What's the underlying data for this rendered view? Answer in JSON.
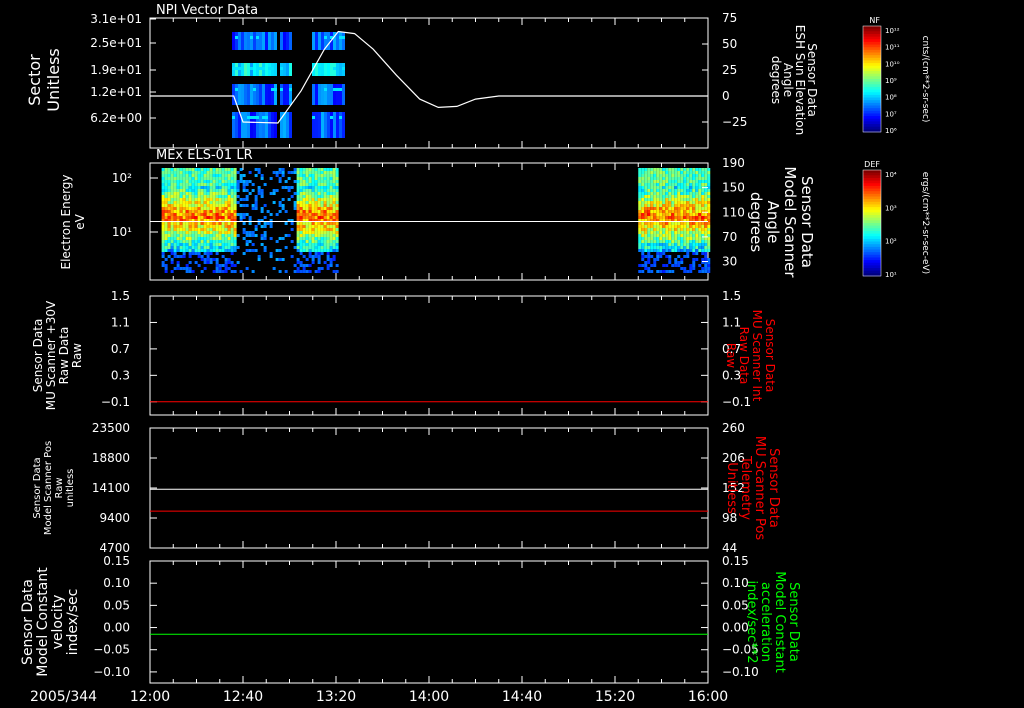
{
  "date_label": "2005/344",
  "x_tick_labels": [
    "12:00",
    "12:40",
    "13:20",
    "14:00",
    "14:40",
    "15:20",
    "16:00"
  ],
  "chart_data": [
    {
      "type": "heatmap",
      "title": "NPI Vector Data",
      "ylabel": [
        "Sector",
        "Unitless"
      ],
      "y_tick_labels": [
        "3.1e+01",
        "2.5e+01",
        "1.9e+01",
        "1.2e+01",
        "6.2e+00"
      ],
      "right_axis": {
        "label": [
          "Sensor Data",
          "ESH Sun Elevation",
          "Angle",
          "degrees"
        ],
        "ticks": [
          75,
          50,
          25,
          0,
          -25
        ],
        "ylim": [
          -50,
          75
        ],
        "line_color": "#ffffff",
        "line": {
          "x": [
            "12:00",
            "12:36",
            "12:40",
            "12:55",
            "13:05",
            "13:15",
            "13:21",
            "13:28",
            "13:36",
            "13:46",
            "13:56",
            "14:04",
            "14:12",
            "14:20",
            "14:30",
            "16:00"
          ],
          "y": [
            0,
            0,
            -25,
            -26,
            5,
            45,
            62,
            60,
            45,
            20,
            -3,
            -11,
            -10,
            -3,
            0,
            0
          ]
        }
      },
      "colorbar": {
        "label": "NF",
        "unit": "cnts/(cm**2-sr-sec)",
        "tick_labels": [
          "10¹²",
          "10¹¹",
          "10¹⁰",
          "10⁹",
          "10⁸",
          "10⁷",
          "10⁶"
        ]
      }
    },
    {
      "type": "heatmap",
      "title": "MEx ELS-01 LR",
      "ylabel": [
        "Electron Energy",
        "eV"
      ],
      "y_tick_labels": [
        "10²",
        "10¹"
      ],
      "data_coverage": [
        [
          "12:05",
          "13:20"
        ],
        [
          "15:30",
          "16:00"
        ]
      ],
      "right_axis": {
        "label": [
          "Sensor Data",
          "Model Scanner",
          "Angle",
          "degrees"
        ],
        "ticks": [
          190,
          150,
          110,
          70,
          30
        ],
        "ylim": [
          0,
          190
        ],
        "line_color": "#ffffff",
        "constant_value": 95
      },
      "colorbar": {
        "label": "DEF",
        "unit": "ergs/(cm**2-sr-sec-eV)",
        "tick_labels": [
          "10⁴",
          "10³",
          "10²",
          "10¹"
        ]
      }
    },
    {
      "type": "line",
      "ylabel": [
        "Sensor Data",
        "MU Scanner +30V",
        "Raw Data",
        "Raw"
      ],
      "y_tick_labels": [
        "1.5",
        "1.1",
        "0.7",
        "0.3",
        "-0.1"
      ],
      "ylim": [
        -0.3,
        1.5
      ],
      "series": [
        {
          "constant_value": -0.1,
          "color": "#ff0000"
        }
      ],
      "right_axis": {
        "label": [
          "Sensor Data",
          "MU Scanner Int",
          "Raw Data",
          "Raw"
        ],
        "label_color": "#ff0000",
        "ticks": [
          "1.5",
          "1.1",
          "0.7",
          "0.3",
          "-0.1"
        ]
      }
    },
    {
      "type": "line",
      "ylabel": [
        "Sensor Data",
        "Model Scanner Pos",
        "Raw",
        "unitless"
      ],
      "y_tick_labels": [
        "23500",
        "18800",
        "14100",
        "9400",
        "4700"
      ],
      "ylim": [
        0,
        23500
      ],
      "series": [
        {
          "constant_value": 11500,
          "color": "#ffffff"
        }
      ],
      "right_axis": {
        "label": [
          "Sensor Data",
          "MU Scanner Pos",
          "Telemetry",
          "Unitless"
        ],
        "label_color": "#ff0000",
        "ticks": [
          "260",
          "206",
          "152",
          "98",
          "44"
        ],
        "ylim": [
          0,
          260
        ],
        "series": [
          {
            "constant_value": 80,
            "color": "#ff0000"
          }
        ]
      }
    },
    {
      "type": "line",
      "ylabel": [
        "Sensor Data",
        "Model Constant",
        "velocity",
        "index/sec"
      ],
      "y_tick_labels": [
        "0.15",
        "0.10",
        "0.05",
        "0.00",
        "-0.05",
        "-0.10"
      ],
      "ylim": [
        -0.1,
        0.15
      ],
      "series": [
        {
          "constant_value": 0.0,
          "color": "#00ff00"
        }
      ],
      "right_axis": {
        "label": [
          "Sensor Data",
          "Model Constant",
          "acceleration",
          "index/sec**2"
        ],
        "label_color": "#00ff00",
        "ticks": [
          "0.15",
          "0.10",
          "0.05",
          "0.00",
          "-0.05",
          "-0.10"
        ]
      }
    }
  ]
}
